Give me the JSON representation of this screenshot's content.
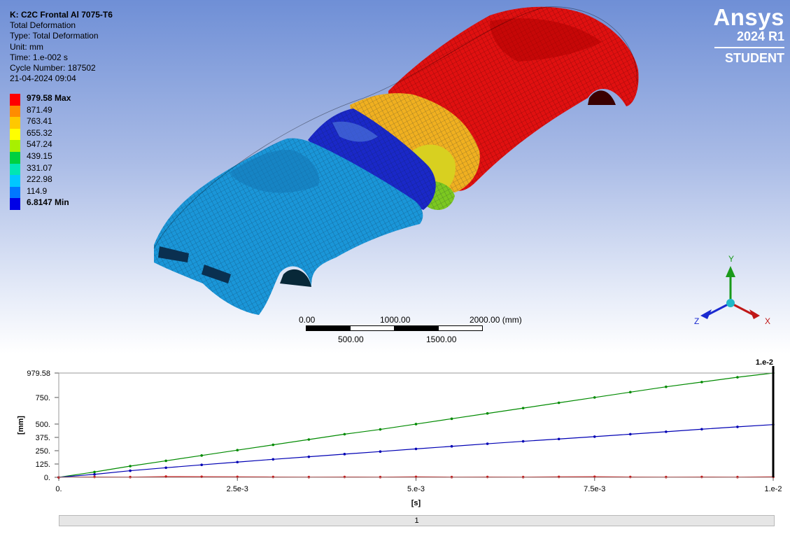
{
  "info": {
    "title": "K: C2C Frontal Al 7075-T6",
    "lines": [
      "Total Deformation",
      "Type: Total Deformation",
      "Unit: mm",
      "Time: 1.e-002 s",
      "Cycle Number: 187502",
      "21-04-2024 09:04"
    ]
  },
  "legend": {
    "items": [
      {
        "label": "979.58 Max",
        "color": "#ff0000"
      },
      {
        "label": "871.49",
        "color": "#ff8c00"
      },
      {
        "label": "763.41",
        "color": "#ffc800"
      },
      {
        "label": "655.32",
        "color": "#ffff00"
      },
      {
        "label": "547.24",
        "color": "#a8f000"
      },
      {
        "label": "439.15",
        "color": "#00d040"
      },
      {
        "label": "331.07",
        "color": "#00e6b4"
      },
      {
        "label": "222.98",
        "color": "#00c8ff"
      },
      {
        "label": "114.9",
        "color": "#0078ff"
      },
      {
        "label": "6.8147 Min",
        "color": "#0000e6"
      }
    ]
  },
  "brand": {
    "name": "Ansys",
    "version": "2024 R1",
    "edition": "STUDENT"
  },
  "scalebar": {
    "top_labels": [
      "0.00",
      "1000.00",
      "2000.00 (mm)"
    ],
    "bottom_labels": [
      "500.00",
      "1500.00"
    ]
  },
  "triad": {
    "x": "X",
    "y": "Y",
    "z": "Z"
  },
  "chart_data": {
    "type": "line",
    "x_label": "[s]",
    "y_label": "[mm]",
    "x_ticks": [
      "0.",
      "2.5e-3",
      "5.e-3",
      "7.5e-3",
      "1.e-2"
    ],
    "y_ticks": [
      "0.",
      "125.",
      "250.",
      "375.",
      "500.",
      "750.",
      "979.58"
    ],
    "xlim": [
      0,
      0.01
    ],
    "ylim": [
      0,
      979.58
    ],
    "cursor_label": "1.e-2",
    "x": [
      0,
      0.0005,
      0.001,
      0.0015,
      0.002,
      0.0025,
      0.003,
      0.0035,
      0.004,
      0.0045,
      0.005,
      0.0055,
      0.006,
      0.0065,
      0.007,
      0.0075,
      0.008,
      0.0085,
      0.009,
      0.0095,
      0.01
    ],
    "series": [
      {
        "color": "#008a00",
        "values": [
          0,
          50,
          105,
          155,
          205,
          255,
          305,
          355,
          405,
          450,
          500,
          550,
          600,
          650,
          700,
          750,
          800,
          850,
          895,
          940,
          979.58
        ]
      },
      {
        "color": "#0000b4",
        "values": [
          0,
          28,
          62,
          90,
          117,
          143,
          169,
          193,
          218,
          242,
          267,
          291,
          315,
          338,
          360,
          382,
          405,
          428,
          452,
          474,
          495
        ]
      },
      {
        "color": "#c80000",
        "values": [
          0,
          3,
          2,
          6,
          5,
          4,
          3,
          2,
          3,
          2,
          4,
          2,
          3,
          2,
          4,
          5,
          3,
          2,
          3,
          2,
          4
        ]
      }
    ]
  },
  "timeline": {
    "label": "1"
  }
}
